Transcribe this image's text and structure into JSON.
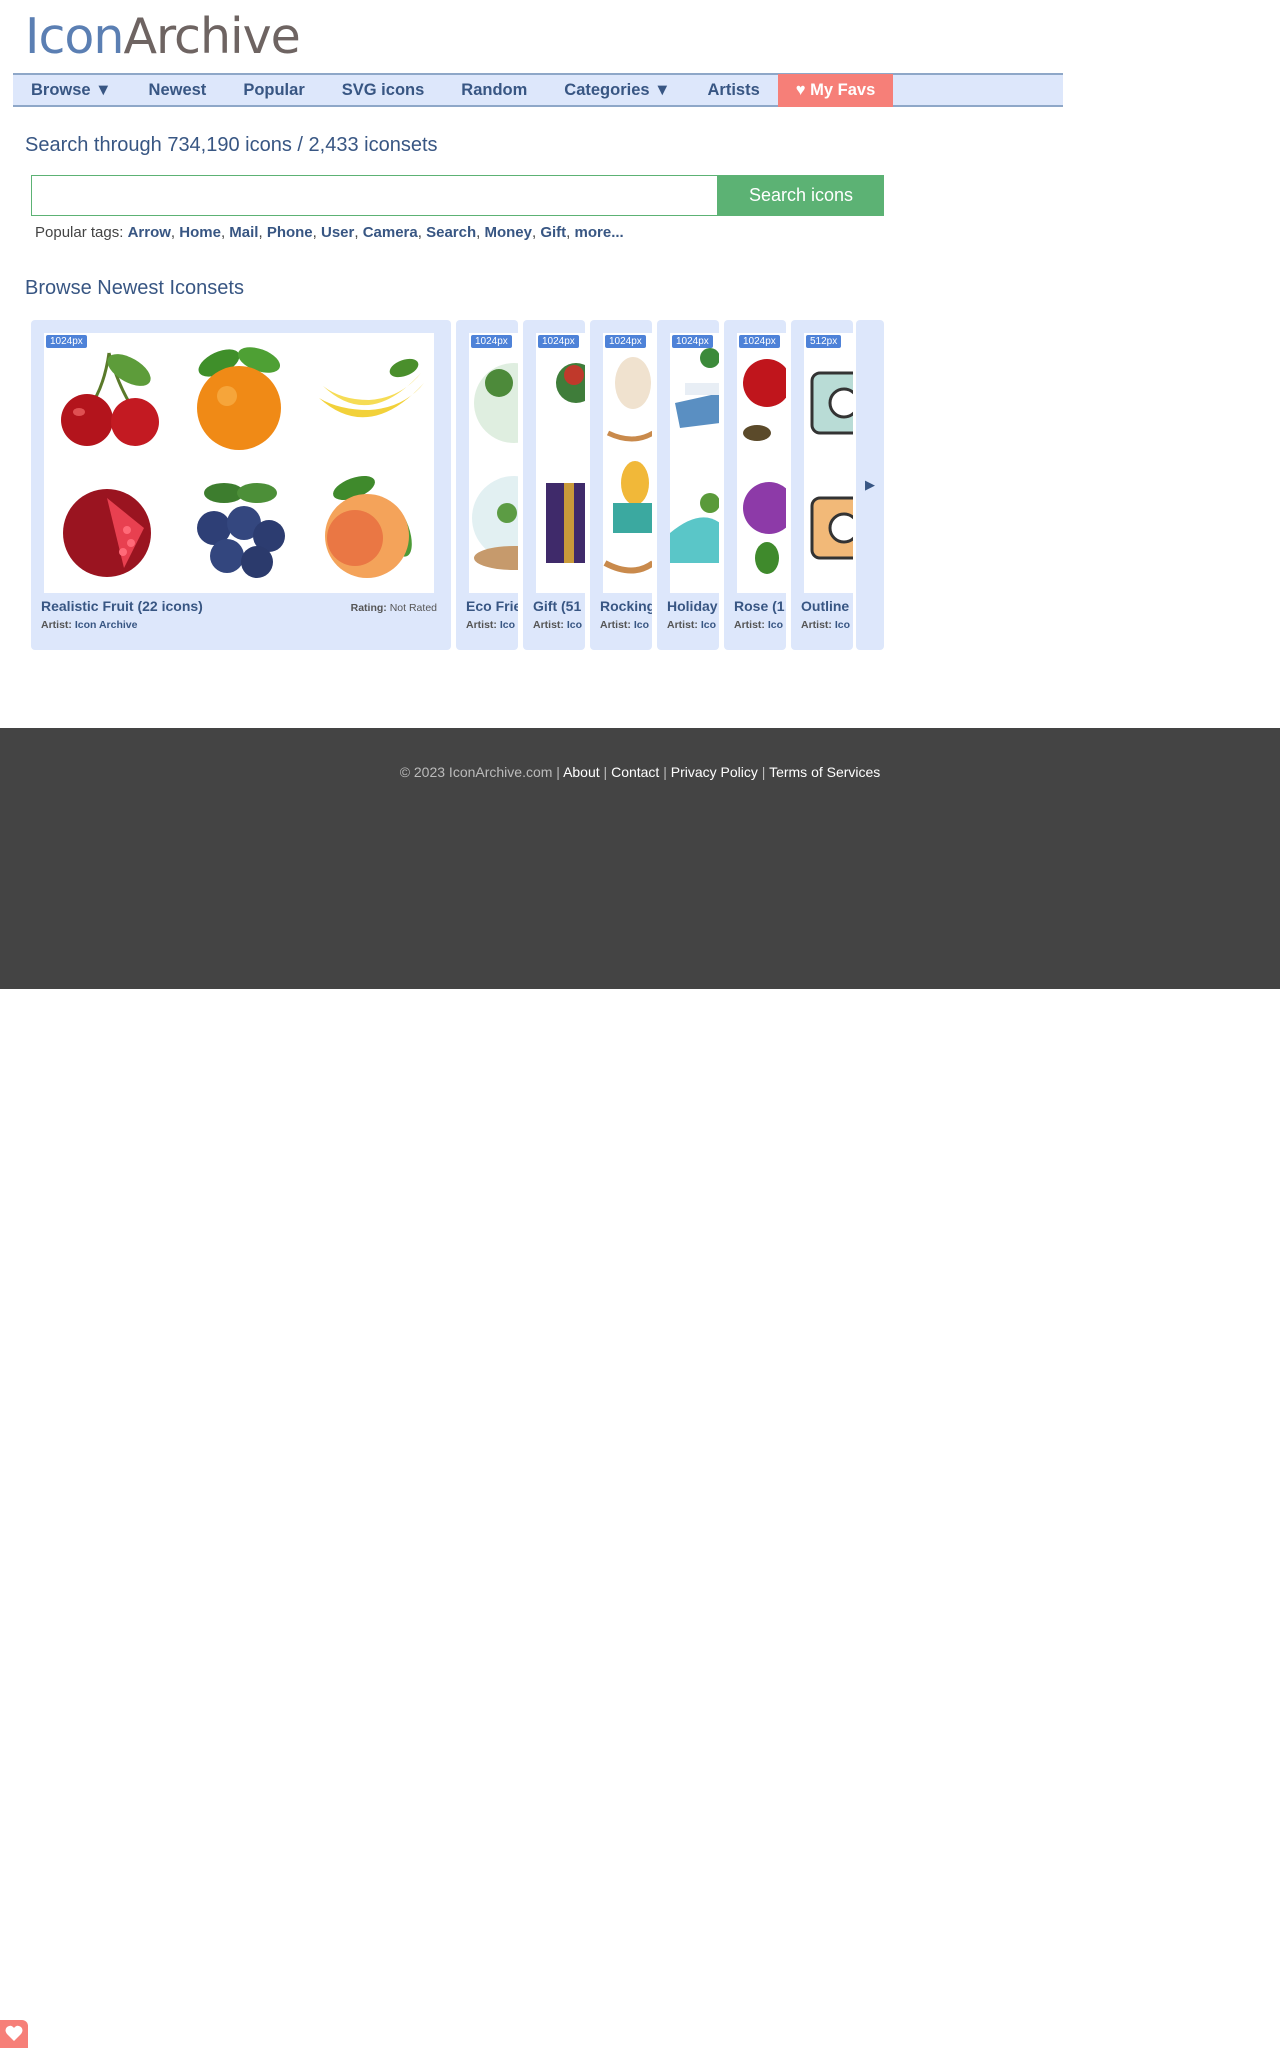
{
  "logo": {
    "part1": "Icon",
    "part2": "Archive"
  },
  "nav": {
    "browse": "Browse ▼",
    "newest": "Newest",
    "popular": "Popular",
    "svg": "SVG icons",
    "random": "Random",
    "categories": "Categories ▼",
    "artists": "Artists",
    "favs": "♥ My Favs"
  },
  "search": {
    "heading": "Search through 734,190 icons / 2,433 iconsets",
    "placeholder": "",
    "button": "Search icons"
  },
  "tags": {
    "label": "Popular tags:",
    "items": [
      "Arrow",
      "Home",
      "Mail",
      "Phone",
      "User",
      "Camera",
      "Search",
      "Money",
      "Gift",
      "more..."
    ]
  },
  "browse": {
    "heading": "Browse Newest Iconsets",
    "artist_label": "Artist:",
    "rating_label": "Rating:",
    "sets": [
      {
        "size": "1024px",
        "title": "Realistic Fruit (22 icons)",
        "artist": "Icon Archive",
        "rating": "Not Rated"
      },
      {
        "size": "1024px",
        "title": "Eco Frie",
        "artist": "Ico"
      },
      {
        "size": "1024px",
        "title": "Gift (51",
        "artist": "Ico"
      },
      {
        "size": "1024px",
        "title": "Rocking",
        "artist": "Ico"
      },
      {
        "size": "1024px",
        "title": "Holiday",
        "artist": "Ico"
      },
      {
        "size": "1024px",
        "title": "Rose (1!",
        "artist": "Ico"
      },
      {
        "size": "512px",
        "title": "Outline",
        "artist": "Ico"
      }
    ],
    "next_arrow": "▶"
  },
  "footer": {
    "copyright": "© 2023 IconArchive.com |",
    "about": "About",
    "contact": "Contact",
    "privacy": "Privacy Policy",
    "terms": "Terms of Services",
    "sep": "|"
  },
  "colors": {
    "brand_blue": "#385683",
    "nav_bg": "#dde7fb",
    "green": "#5cb274",
    "favs": "#f67f78",
    "footer_bg": "#444444"
  },
  "icons": {
    "float_fav": "heart-icon"
  }
}
